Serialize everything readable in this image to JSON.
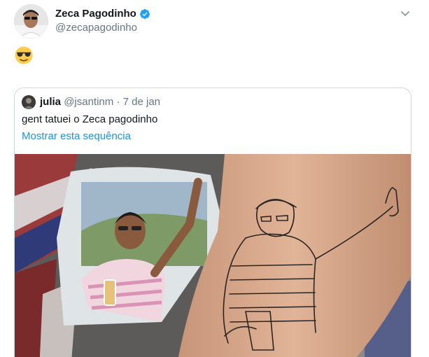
{
  "tweet": {
    "author_name": "Zeca Pagodinho",
    "author_handle": "@zecapagodinho",
    "verified": true,
    "body_emoji": "😎",
    "menu_icon": "chevron-down-icon"
  },
  "quoted_tweet": {
    "author_name": "julia",
    "author_handle": "@jsantinm",
    "separator": "·",
    "date": "7 de jan",
    "text": "gent tatuei o Zeca pagodinho",
    "show_thread_link": "Mostrar esta sequência",
    "media_description": "photo of a tattoo beside a printed photo"
  },
  "colors": {
    "link": "#1b95e0",
    "verified": "#1da1f2",
    "secondary_text": "#657786",
    "border": "#ccd6dd"
  }
}
